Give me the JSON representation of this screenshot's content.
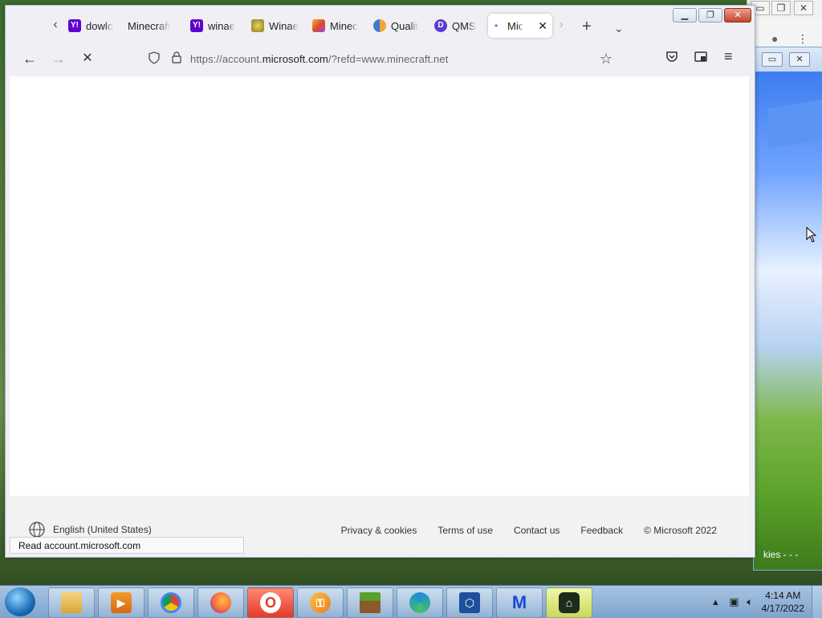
{
  "browser": {
    "tabs": [
      {
        "label": "dowlo",
        "favicon": "Y!",
        "color": "#5f01d1"
      },
      {
        "label": "Minecraft",
        "favicon": "",
        "color": ""
      },
      {
        "label": "winae",
        "favicon": "Y!",
        "color": "#5f01d1"
      },
      {
        "label": "Winae",
        "favicon": "",
        "color": "#c7b53a"
      },
      {
        "label": "Minec",
        "favicon": "",
        "color": "#e86a2c"
      },
      {
        "label": "Qualit",
        "favicon": "",
        "color": "#3a7bd5"
      },
      {
        "label": "QMS",
        "favicon": "D",
        "color": "#5b3bd6"
      },
      {
        "label": "Mic",
        "favicon": "",
        "color": "#3b82f6"
      }
    ],
    "url_prefix": "https://account.",
    "url_domain": "microsoft.com",
    "url_suffix": "/?refd=www.minecraft.net",
    "status_text": "Read account.microsoft.com"
  },
  "footer": {
    "language": "English (United States)",
    "links": [
      "Privacy & cookies",
      "Terms of use",
      "Contact us",
      "Feedback",
      "© Microsoft 2022"
    ]
  },
  "bg_window": {
    "cookies_text": "kies  - - -"
  },
  "taskbar": {
    "time": "4:14 AM",
    "date": "4/17/2022"
  }
}
